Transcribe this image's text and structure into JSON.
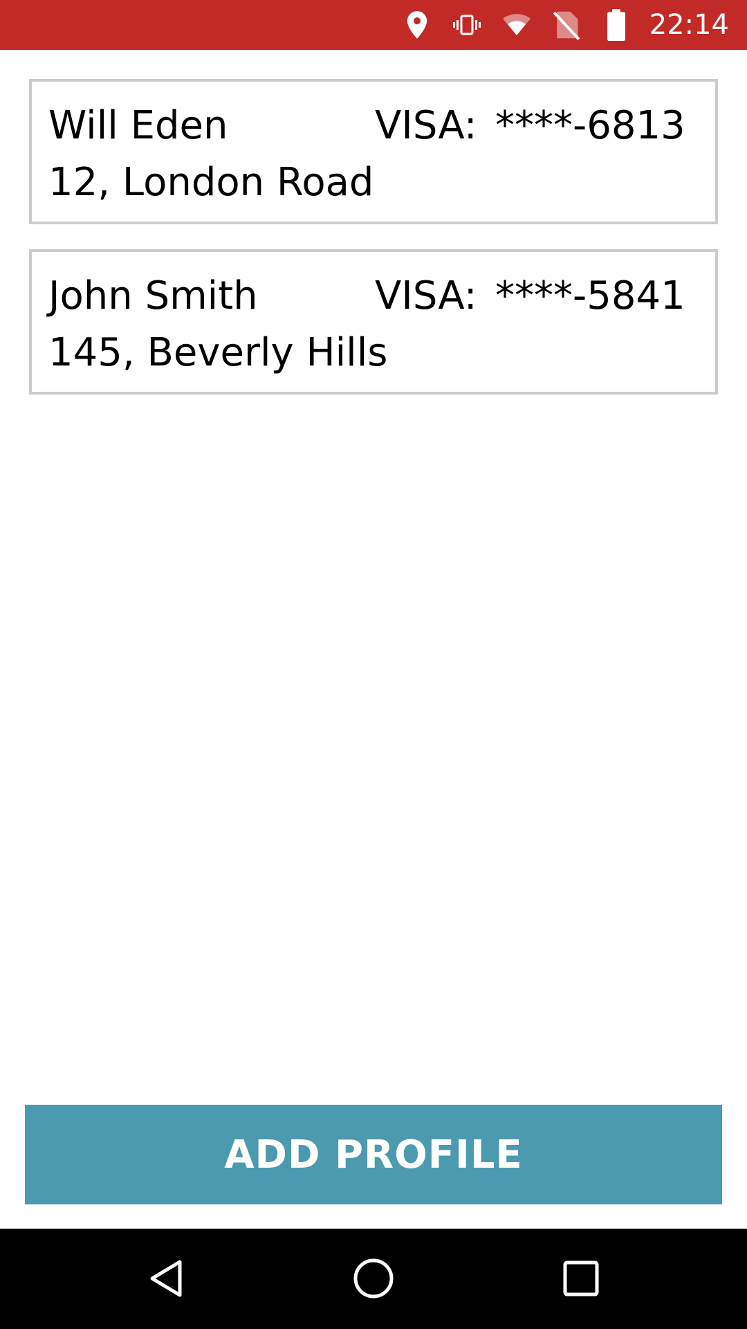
{
  "status_bar": {
    "time": "22:14",
    "background_color": "#c12a27",
    "icons": [
      "location-icon",
      "vibrate-icon",
      "wifi-icon",
      "no-sim-icon",
      "battery-icon"
    ]
  },
  "profiles": [
    {
      "name": "Will Eden",
      "address": "12, London Road",
      "card_brand": "VISA:",
      "card_number": "****-6813"
    },
    {
      "name": "John Smith",
      "address": "145, Beverly Hills",
      "card_brand": "VISA:",
      "card_number": "****-5841"
    }
  ],
  "add_profile_button": {
    "label": "ADD PROFILE",
    "color": "#4c9aaf"
  },
  "nav_bar": {
    "icons": [
      "back-icon",
      "home-icon",
      "recents-icon"
    ]
  }
}
